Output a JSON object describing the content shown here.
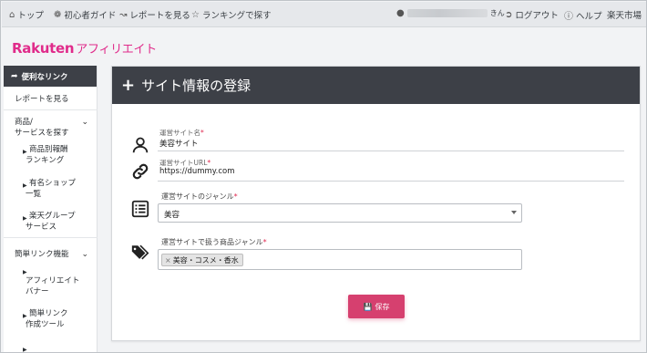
{
  "topbar": {
    "home": "トップ",
    "guide": "初心者ガイド",
    "report": "レポートを見る",
    "ranking": "ランキングで探す",
    "user_suffix": "きん",
    "logout": "ログアウト",
    "help": "ヘルプ",
    "market": "楽天市場"
  },
  "logo": {
    "brand": "Rakuten",
    "sub": "アフィリエイト"
  },
  "sidebar": {
    "header": "便利なリンク",
    "items": [
      {
        "label": "レポートを見る"
      },
      {
        "label": "商品/",
        "label2": "サービスを探す"
      },
      {
        "label": "商品別報酬",
        "label2": "ランキング"
      },
      {
        "label": "有名ショップ",
        "label2": "一覧"
      },
      {
        "label": "楽天グループ",
        "label2": "サービス"
      },
      {
        "label": "簡単リンク機能"
      },
      {
        "label": "アフィリエイト",
        "label2": "バナー"
      },
      {
        "label": "簡単リンク",
        "label2": "作成ツール"
      }
    ]
  },
  "panel": {
    "title": "サイト情報の登録",
    "site_name": {
      "label": "運営サイト名",
      "req": "*",
      "value": "美容サイト"
    },
    "site_url": {
      "label": "運営サイトURL",
      "req": "*",
      "value": "https://dummy.com"
    },
    "genre": {
      "label": "運営サイトのジャンル",
      "req": "*",
      "value": "美容"
    },
    "product_genre": {
      "label": "運営サイトで扱う商品ジャンル",
      "req": "*",
      "tag": "美容・コスメ・香水",
      "tag_remove": "×"
    },
    "save_label": "保存"
  }
}
